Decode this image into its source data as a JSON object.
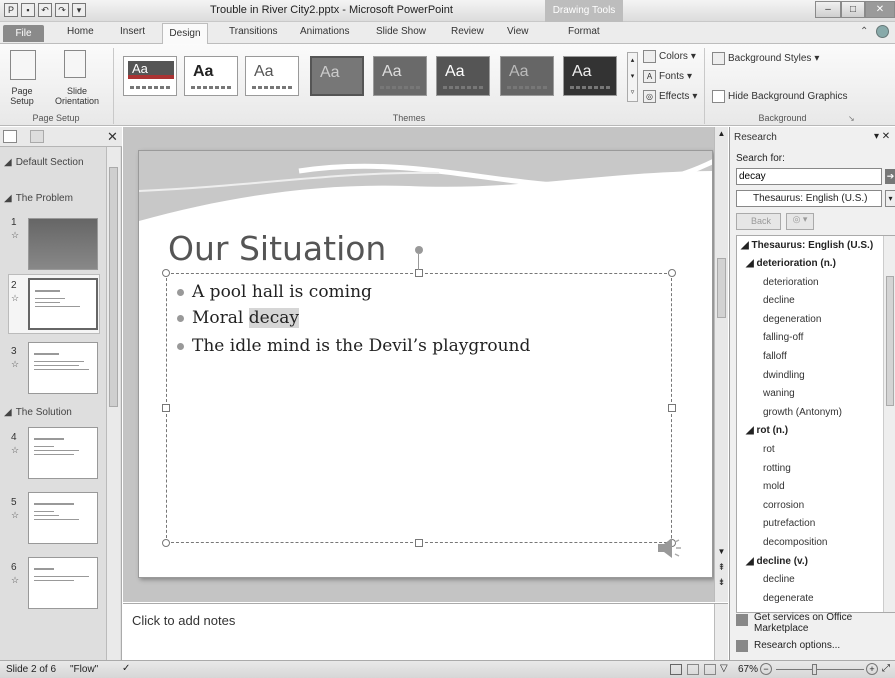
{
  "window": {
    "title": "Trouble in River City2.pptx - Microsoft PowerPoint",
    "contextual_tab_group": "Drawing Tools"
  },
  "tabs": [
    "File",
    "Home",
    "Insert",
    "Design",
    "Transitions",
    "Animations",
    "Slide Show",
    "Review",
    "View",
    "Format"
  ],
  "ribbon": {
    "page_setup": {
      "page_setup_label": "Page\nSetup",
      "orientation_label": "Slide\nOrientation",
      "group_label": "Page Setup"
    },
    "themes": {
      "group_label": "Themes",
      "colors": "Colors",
      "fonts": "Fonts",
      "effects": "Effects",
      "sample": "Aa"
    },
    "background": {
      "styles": "Background Styles",
      "hide": "Hide Background Graphics",
      "group_label": "Background"
    }
  },
  "slides_panel": {
    "sections": [
      "Default Section",
      "The Problem",
      "The Solution"
    ],
    "slide_numbers": [
      "1",
      "2",
      "3",
      "4",
      "5",
      "6"
    ]
  },
  "slide": {
    "title": "Our Situation",
    "bullets": [
      "A pool hall is coming",
      "Moral ",
      "The idle mind is the Devil’s playground"
    ],
    "highlight": "decay"
  },
  "notes": {
    "placeholder": "Click to add notes"
  },
  "research": {
    "title": "Research",
    "search_label": "Search for:",
    "search_value": "decay",
    "source": "Thesaurus: English (U.S.)",
    "back": "Back",
    "results_header": "Thesaurus: English (U.S.)",
    "groups": [
      {
        "head": "deterioration (n.)",
        "items": [
          "deterioration",
          "decline",
          "degeneration",
          "falling-off",
          "falloff",
          "dwindling",
          "waning",
          "growth (Antonym)"
        ]
      },
      {
        "head": "rot (n.)",
        "items": [
          "rot",
          "rotting",
          "mold",
          "corrosion",
          "putrefaction",
          "decomposition"
        ]
      },
      {
        "head": "decline (v.)",
        "items": [
          "decline",
          "degenerate"
        ]
      }
    ],
    "services": "Get services on Office Marketplace",
    "options": "Research options..."
  },
  "status": {
    "slide": "Slide 2 of 6",
    "theme": "\"Flow\"",
    "zoom": "67%"
  }
}
